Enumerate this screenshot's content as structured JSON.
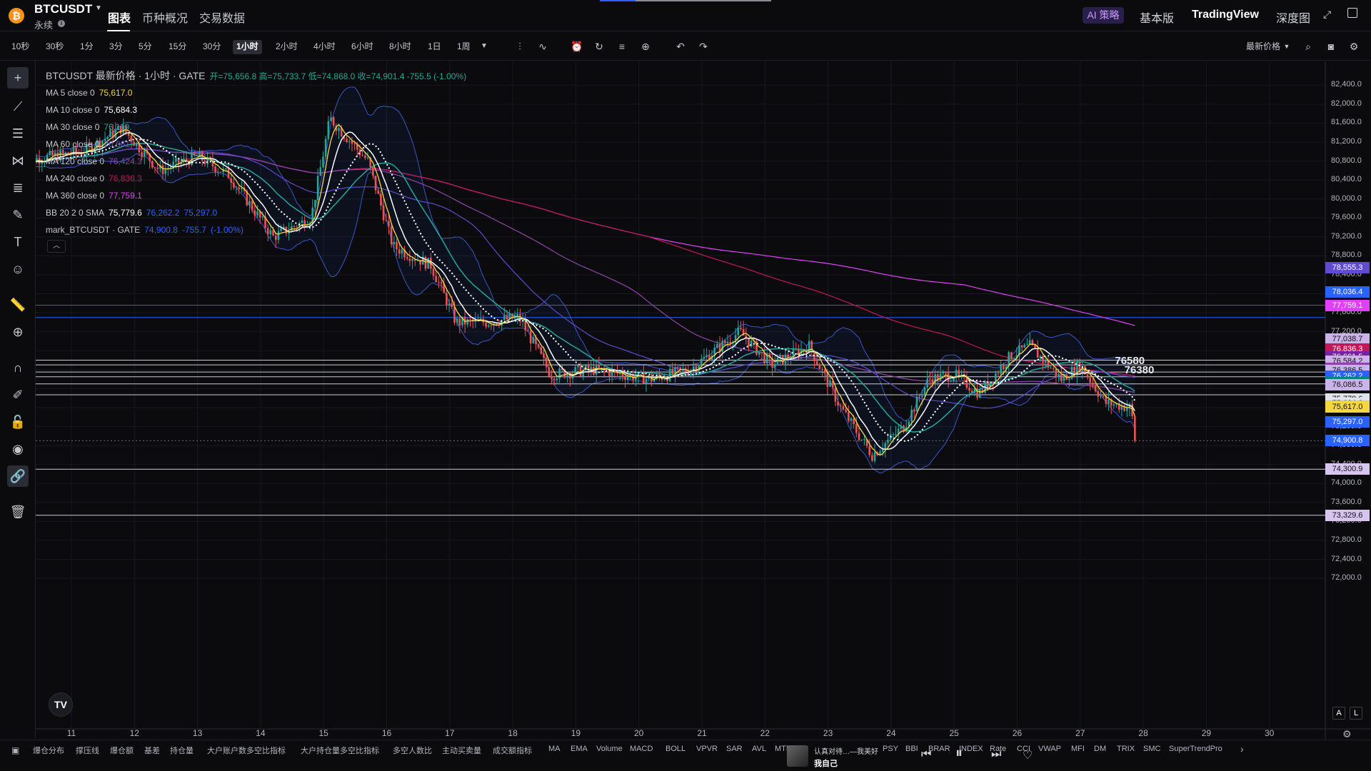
{
  "header": {
    "symbol": "BTCUSDT",
    "contract_type": "永续",
    "tabs": [
      "图表",
      "币种概况",
      "交易数据"
    ],
    "active_tab": "图表",
    "ai_badge": "AI 策略",
    "right": [
      "基本版",
      "TradingView",
      "深度图"
    ]
  },
  "toolbar": {
    "timeframes": [
      "10秒",
      "30秒",
      "1分",
      "3分",
      "5分",
      "15分",
      "30分",
      "1小时",
      "2小时",
      "4小时",
      "6小时",
      "8小时",
      "1日",
      "1周"
    ],
    "active_timeframe": "1小时",
    "price_type": "最新价格"
  },
  "legend": {
    "title": "BTCUSDT 最新价格 · 1小时 · GATE",
    "ohlc": "开=75,656.8 高=75,733.7 低=74,868.0 收=74,901.4 -755.5 (-1.00%)",
    "rows": [
      {
        "name": "MA 5 close 0",
        "vals": [
          "75,617.0"
        ],
        "colors": [
          "#f5d742"
        ]
      },
      {
        "name": "MA 10 close 0",
        "vals": [
          "75,684.3"
        ],
        "colors": [
          "#ffffff"
        ]
      },
      {
        "name": "MA 30 close 0",
        "vals": [
          "76,119."
        ],
        "colors": [
          "#26a69a"
        ]
      },
      {
        "name": "MA 60 close 0",
        "vals": [
          "76,661."
        ],
        "colors": [
          "#5d4bd1"
        ]
      },
      {
        "name": "MA 120 close 0",
        "vals": [
          "76,424.3"
        ],
        "colors": [
          "#8e44ad"
        ]
      },
      {
        "name": "MA 240 close 0",
        "vals": [
          "76,836.3"
        ],
        "colors": [
          "#c2185b"
        ]
      },
      {
        "name": "MA 360 close 0",
        "vals": [
          "77,759.1"
        ],
        "colors": [
          "#e040fb"
        ]
      },
      {
        "name": "BB 20 2 0 SMA",
        "vals": [
          "75,779.6",
          "76,262.2",
          "75,297.0"
        ],
        "colors": [
          "#ffffff",
          "#2962ff",
          "#2962ff"
        ]
      },
      {
        "name": "mark_BTCUSDT · GATE",
        "vals": [
          "74,900.8",
          "-755.7",
          "(-1.00%)"
        ],
        "colors": [
          "#2962ff",
          "#2962ff",
          "#2962ff"
        ]
      }
    ]
  },
  "chart_data": {
    "type": "candlestick",
    "title": "BTCUSDT 最新价格 · 1小时 · GATE",
    "ylim": [
      71700,
      82600
    ],
    "y_ticks": [
      "82,400.0",
      "82,000.0",
      "81,600.0",
      "81,200.0",
      "80,800.0",
      "80,400.0",
      "80,000.0",
      "79,600.0",
      "79,200.0",
      "78,800.0",
      "78,400.0",
      "78,000.0",
      "77,600.0",
      "77,200.0",
      "76,800.0",
      "76,400.0",
      "76,000.0",
      "75,600.0",
      "75,200.0",
      "74,800.0",
      "74,400.0",
      "74,000.0",
      "73,600.0",
      "73,200.0",
      "72,800.0",
      "72,400.0",
      "72,000.0"
    ],
    "x_ticks": [
      "11",
      "12",
      "13",
      "14",
      "15",
      "16",
      "17",
      "18",
      "19",
      "20",
      "21",
      "22",
      "23",
      "24",
      "25",
      "26",
      "27",
      "28",
      "29",
      "30"
    ],
    "price_waypoints": [
      {
        "day": 10.2,
        "price": 80800
      },
      {
        "day": 11.2,
        "price": 81000
      },
      {
        "day": 11.8,
        "price": 81500
      },
      {
        "day": 12.4,
        "price": 80600
      },
      {
        "day": 13.0,
        "price": 80900
      },
      {
        "day": 13.5,
        "price": 80500
      },
      {
        "day": 14.2,
        "price": 79200
      },
      {
        "day": 14.8,
        "price": 79600
      },
      {
        "day": 15.1,
        "price": 81700
      },
      {
        "day": 15.7,
        "price": 80800
      },
      {
        "day": 16.1,
        "price": 79000
      },
      {
        "day": 16.7,
        "price": 78600
      },
      {
        "day": 17.1,
        "price": 77400
      },
      {
        "day": 17.6,
        "price": 77400
      },
      {
        "day": 18.1,
        "price": 77500
      },
      {
        "day": 18.6,
        "price": 76300
      },
      {
        "day": 19.3,
        "price": 76400
      },
      {
        "day": 20.2,
        "price": 76200
      },
      {
        "day": 20.8,
        "price": 76400
      },
      {
        "day": 21.6,
        "price": 77200
      },
      {
        "day": 22.1,
        "price": 76500
      },
      {
        "day": 22.7,
        "price": 76900
      },
      {
        "day": 23.2,
        "price": 75600
      },
      {
        "day": 23.7,
        "price": 74600
      },
      {
        "day": 24.2,
        "price": 75200
      },
      {
        "day": 24.6,
        "price": 76200
      },
      {
        "day": 25.0,
        "price": 76300
      },
      {
        "day": 25.4,
        "price": 75900
      },
      {
        "day": 25.9,
        "price": 76700
      },
      {
        "day": 26.2,
        "price": 76900
      },
      {
        "day": 26.7,
        "price": 76200
      },
      {
        "day": 27.0,
        "price": 76500
      },
      {
        "day": 27.4,
        "price": 75700
      },
      {
        "day": 27.8,
        "price": 75600
      },
      {
        "day": 27.88,
        "price": 74901.4
      }
    ],
    "ma": [
      {
        "name": "MA 5",
        "value": 75617.0,
        "color": "#f5d742"
      },
      {
        "name": "MA 10",
        "value": 75684.3,
        "color": "#ffffff"
      },
      {
        "name": "MA 30",
        "value": 76119,
        "color": "#26a69a"
      },
      {
        "name": "MA 60",
        "value": 76661,
        "color": "#5d4bd1"
      },
      {
        "name": "MA 120",
        "value": 76424.3,
        "color": "#8e44ad"
      },
      {
        "name": "MA 240",
        "value": 76836.3,
        "color": "#c2185b"
      },
      {
        "name": "MA 360",
        "value": 77759.1,
        "color": "#e040fb"
      }
    ],
    "bollinger": {
      "basis": 75779.6,
      "upper": 76262.2,
      "lower": 75297.0
    },
    "h_lines": [
      {
        "price": 77759.1,
        "color": "#5d4bd1"
      },
      {
        "price": 77500,
        "color": "#2962ff"
      },
      {
        "price": 76600,
        "color": "#c9ccd3"
      },
      {
        "price": 76500,
        "color": "#c9ccd3"
      },
      {
        "price": 76350,
        "color": "#c9ccd3"
      },
      {
        "price": 76250,
        "color": "#c9ccd3"
      },
      {
        "price": 76100,
        "color": "#c9ccd3"
      },
      {
        "price": 75870,
        "color": "#c9ccd3"
      },
      {
        "price": 74300.9,
        "color": "#c9ccd3"
      },
      {
        "price": 73329.6,
        "color": "#c9ccd3"
      }
    ],
    "last_price_line": 74901.4,
    "annotations": [
      "76580",
      "76380"
    ]
  },
  "price_labels": [
    {
      "text": "78,555.3",
      "price": 78555.3,
      "bg": "#5d4bd1"
    },
    {
      "text": "78,036.4",
      "price": 78036.4,
      "bg": "#2962ff"
    },
    {
      "text": "77,759.1",
      "price": 77759.1,
      "bg": "#e040fb"
    },
    {
      "text": "77,038.7",
      "price": 77038.7,
      "bg": "#c9b3e8",
      "fg": "#111"
    },
    {
      "text": "76,847.8",
      "price": 76847.8,
      "bg": "#c9b3e8",
      "fg": "#111"
    },
    {
      "text": "76,836.3",
      "price": 76836.3,
      "bg": "#c2185b"
    },
    {
      "text": "76,661.5",
      "price": 76661.5,
      "bg": "#7b1fa2"
    },
    {
      "text": "76,584.2",
      "price": 76584.2,
      "bg": "#c9b3e8",
      "fg": "#111"
    },
    {
      "text": "76,424.3",
      "price": 76424.3,
      "bg": "#8e44ad"
    },
    {
      "text": "76,386.5",
      "price": 76386.5,
      "bg": "#c9b3e8",
      "fg": "#111"
    },
    {
      "text": "76,262.2",
      "price": 76262.2,
      "bg": "#2962ff"
    },
    {
      "text": "76,119.1",
      "price": 76119.1,
      "bg": "#00897b"
    },
    {
      "text": "76,086.5",
      "price": 76086.5,
      "bg": "#c9b3e8",
      "fg": "#111"
    },
    {
      "text": "75,779.6",
      "price": 75779.6,
      "bg": "#e0e3ea",
      "fg": "#111"
    },
    {
      "text": "75,684.3",
      "price": 75684.3,
      "bg": "#e0e3ea",
      "fg": "#111"
    },
    {
      "text": "75,631.8",
      "price": 75631.8,
      "bg": "#c9b3e8",
      "fg": "#111"
    },
    {
      "text": "75,617.0",
      "price": 75617.0,
      "bg": "#f5d742",
      "fg": "#111"
    },
    {
      "text": "75,297.0",
      "price": 75297.0,
      "bg": "#2962ff"
    },
    {
      "text": "74,901.4",
      "price": 74901.4,
      "bg": "#22ab94"
    },
    {
      "text": "74,900.8",
      "price": 74900.8,
      "bg": "#2962ff"
    },
    {
      "text": "74,300.9",
      "price": 74300.9,
      "bg": "#d7c5ef",
      "fg": "#111"
    },
    {
      "text": "73,329.6",
      "price": 73329.6,
      "bg": "#d7c5ef",
      "fg": "#111"
    }
  ],
  "bottom": {
    "indicators": [
      "爆仓分布",
      "撑压线",
      "爆仓额",
      "基差",
      "持仓量",
      "大户账户数多空比指标",
      "大户持仓量多空比指标",
      "多空人数比",
      "主动买卖量",
      "成交额指标",
      "MA",
      "EMA",
      "Volume",
      "MACD",
      "BOLL",
      "VPVR",
      "SAR",
      "AVL",
      "MTM",
      "PSY",
      "BBI",
      "BRAR",
      "INDEX",
      "Rate",
      "CCI",
      "VWAP",
      "MFI",
      "DM",
      "TRIX",
      "SMC",
      "SuperTrendPro"
    ],
    "song_title": "认真对待…—我美好",
    "song_artist": "我自己",
    "axis_buttons": [
      "A",
      "L"
    ],
    "tv_badge": "TV"
  }
}
